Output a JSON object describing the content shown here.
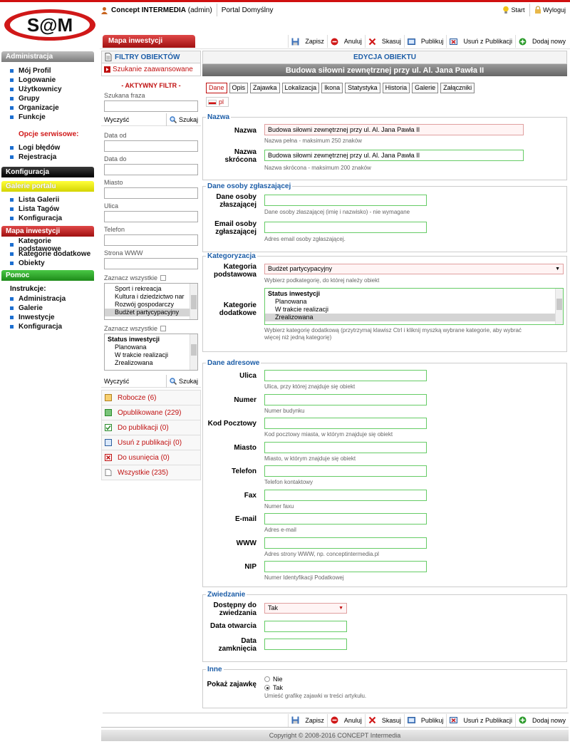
{
  "header": {
    "logo_text": "S@M",
    "user_name": "Concept INTERMEDIA",
    "user_role": "(admin)",
    "portal": "Portal Domyślny",
    "start": "Start",
    "logout": "Wyloguj"
  },
  "nav": {
    "admin": {
      "title": "Administracja",
      "items": [
        "Mój Profil",
        "Logowanie",
        "Użytkownicy",
        "Grupy",
        "Organizacje",
        "Funkcje"
      ]
    },
    "service": {
      "title": "Opcje serwisowe:",
      "items": [
        "Logi błędów",
        "Rejestracja"
      ]
    },
    "config": {
      "title": "Konfiguracja"
    },
    "gallery": {
      "title": "Galerie portalu",
      "items": [
        "Lista Galerii",
        "Lista Tagów",
        "Konfiguracja"
      ]
    },
    "map": {
      "title": "Mapa inwestycji",
      "items": [
        "Kategorie podstawowe",
        "Kategorie dodatkowe",
        "Obiekty"
      ]
    },
    "help": {
      "title": "Pomoc",
      "subtitle": "Instrukcje:",
      "items": [
        "Administracja",
        "Galerie",
        "Inwestycje",
        "Konfiguracja"
      ]
    }
  },
  "toolbar": {
    "section_tab": "Mapa inwestycji",
    "buttons": [
      "Zapisz",
      "Anuluj",
      "Skasuj",
      "Publikuj",
      "Usuń z Publikacji",
      "Dodaj nowy"
    ]
  },
  "filters": {
    "title": "FILTRY OBIEKTÓW",
    "advanced": "Szukanie zaawansowane",
    "active": "- AKTYWNY FILTR -",
    "phrase_label": "Szukana fraza",
    "clear": "Wyczyść",
    "search": "Szukaj",
    "date_from": "Data od",
    "date_to": "Data do",
    "city": "Miasto",
    "street": "Ulica",
    "phone": "Telefon",
    "www": "Strona WWW",
    "select_all": "Zaznacz wszystkie",
    "cat_list": [
      "Sport i rekreacja",
      "Kultura i dziedzictwo nar",
      "Rozwój gospodarczy",
      "Budżet partycypacyjny"
    ],
    "status_list_group": "Status inwestycji",
    "status_list": [
      "Planowana",
      "W trakcie realizacji",
      "Zrealizowana"
    ],
    "statuses": [
      {
        "label": "Robocze (6)",
        "color": "#c01010"
      },
      {
        "label": "Opublikowane (229)",
        "color": "#c01010"
      },
      {
        "label": "Do publikacji (0)",
        "color": "#c01010"
      },
      {
        "label": "Usuń z publikacji (0)",
        "color": "#c01010"
      },
      {
        "label": "Do usunięcia (0)",
        "color": "#c01010"
      },
      {
        "label": "Wszystkie (235)",
        "color": "#c01010"
      }
    ]
  },
  "edit": {
    "header": "EDYCJA OBIEKTU",
    "title": "Budowa siłowni zewnętrznej przy ul. Al. Jana Pawła II",
    "tabs": [
      "Dane",
      "Opis",
      "Zajawka",
      "Lokalizacja",
      "Ikona",
      "Statystyka",
      "Historia",
      "Galerie",
      "Załączniki"
    ],
    "lang": "pl",
    "name_section": {
      "legend": "Nazwa",
      "name_label": "Nazwa",
      "name_value": "Budowa siłowni zewnętrznej przy ul. Al. Jana Pawła II",
      "name_hint": "Nazwa pełna - maksimum 250 znaków",
      "short_label_1": "Nazwa",
      "short_label_2": "skrócona",
      "short_value": "Budowa siłowni zewnętrznej przy ul. Al. Jana Pawła II",
      "short_hint": "Nazwa skrócona - maksimum 200 znaków"
    },
    "person_section": {
      "legend": "Dane osoby zgłaszającej",
      "person_label_1": "Dane osoby",
      "person_label_2": "złaszającej",
      "person_hint": "Dane osoby złaszającej (imię i nazwisko) - nie wymagane",
      "email_label_1": "Email osoby",
      "email_label_2": "zgłaszającej",
      "email_hint": "Adres email osoby zgłaszającej."
    },
    "cat_section": {
      "legend": "Kategoryzacja",
      "main_label_1": "Kategoria",
      "main_label_2": "podstawowa",
      "main_value": "Budżet partycypacyjny",
      "main_hint": "Wybierz podkategorię, do której należy obiekt",
      "extra_label_1": "Kategorie",
      "extra_label_2": "dodatkowe",
      "extra_group": "Status inwestycji",
      "extra_items": [
        "Planowana",
        "W trakcie realizacji",
        "Zrealizowana"
      ],
      "extra_hint_1": "Wybierz kategorię dodatkową (przytrzymaj klawisz Ctrl i kliknij myszką wybrane kategorie, aby wybrać",
      "extra_hint_2": "więcej niż jedną kategorię)"
    },
    "addr_section": {
      "legend": "Dane adresowe",
      "fields": [
        {
          "label": "Ulica",
          "hint": "Ulica, przy której znajduje się obiekt"
        },
        {
          "label": "Numer",
          "hint": "Numer budynku"
        },
        {
          "label": "Kod Pocztowy",
          "hint": "Kod pocztowy miasta, w którym znajduje się obiekt"
        },
        {
          "label": "Miasto",
          "hint": "Miasto, w którym znajduje się obiekt"
        },
        {
          "label": "Telefon",
          "hint": "Telefon kontaktowy"
        },
        {
          "label": "Fax",
          "hint": "Numer faxu"
        },
        {
          "label": "E-mail",
          "hint": "Adres e-mail"
        },
        {
          "label": "WWW",
          "hint": "Adres strony WWW, np. conceptintermedia.pl"
        },
        {
          "label": "NIP",
          "hint": "Numer Identyfikacji Podatkowej"
        }
      ]
    },
    "visit_section": {
      "legend": "Zwiedzanie",
      "avail_label_1": "Dostępny do",
      "avail_label_2": "zwiedzania",
      "avail_value": "Tak",
      "open_label": "Data otwarcia",
      "close_label_1": "Data",
      "close_label_2": "zamknięcia"
    },
    "other_section": {
      "legend": "Inne",
      "teaser_label": "Pokaż zajawkę",
      "opt_no": "Nie",
      "opt_yes": "Tak",
      "hint": "Umieść grafikę zajawki w treści artykułu."
    }
  },
  "footer": {
    "copyright": "Copyright © 2008-2016 CONCEPT Intermedia"
  }
}
